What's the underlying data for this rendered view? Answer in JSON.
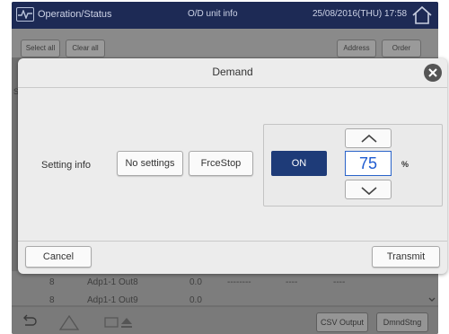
{
  "header": {
    "title": "Operation/Status",
    "center_info": "O/D unit info",
    "datetime": "25/08/2016(THU) 17:58"
  },
  "background": {
    "toolbar": {
      "select_all": "Select all",
      "clear_all": "Clear all",
      "address": "Address",
      "order": "Order"
    },
    "edge_left": "S",
    "edge_right": "2",
    "rows": [
      {
        "num": "8",
        "name": "Adp1-1 Out8",
        "value": "0.0",
        "dash1": "--------",
        "dash2": "----",
        "dash3": "----"
      },
      {
        "num": "8",
        "name": "Adp1-1 Out9",
        "value": "0.0",
        "dash1": "",
        "dash2": "",
        "dash3": ""
      }
    ],
    "bottom": {
      "csv_output": "CSV Output",
      "dmnd_stng": "DmndStng"
    }
  },
  "dialog": {
    "title": "Demand",
    "setting_label": "Setting info",
    "no_settings": "No settings",
    "frce_stop": "FrceStop",
    "on_label": "ON",
    "value": "75",
    "unit": "%",
    "cancel": "Cancel",
    "transmit": "Transmit"
  },
  "colors": {
    "header_bg": "#1d2a55",
    "on_button": "#1e3b78",
    "value_text": "#1e5bd0"
  }
}
